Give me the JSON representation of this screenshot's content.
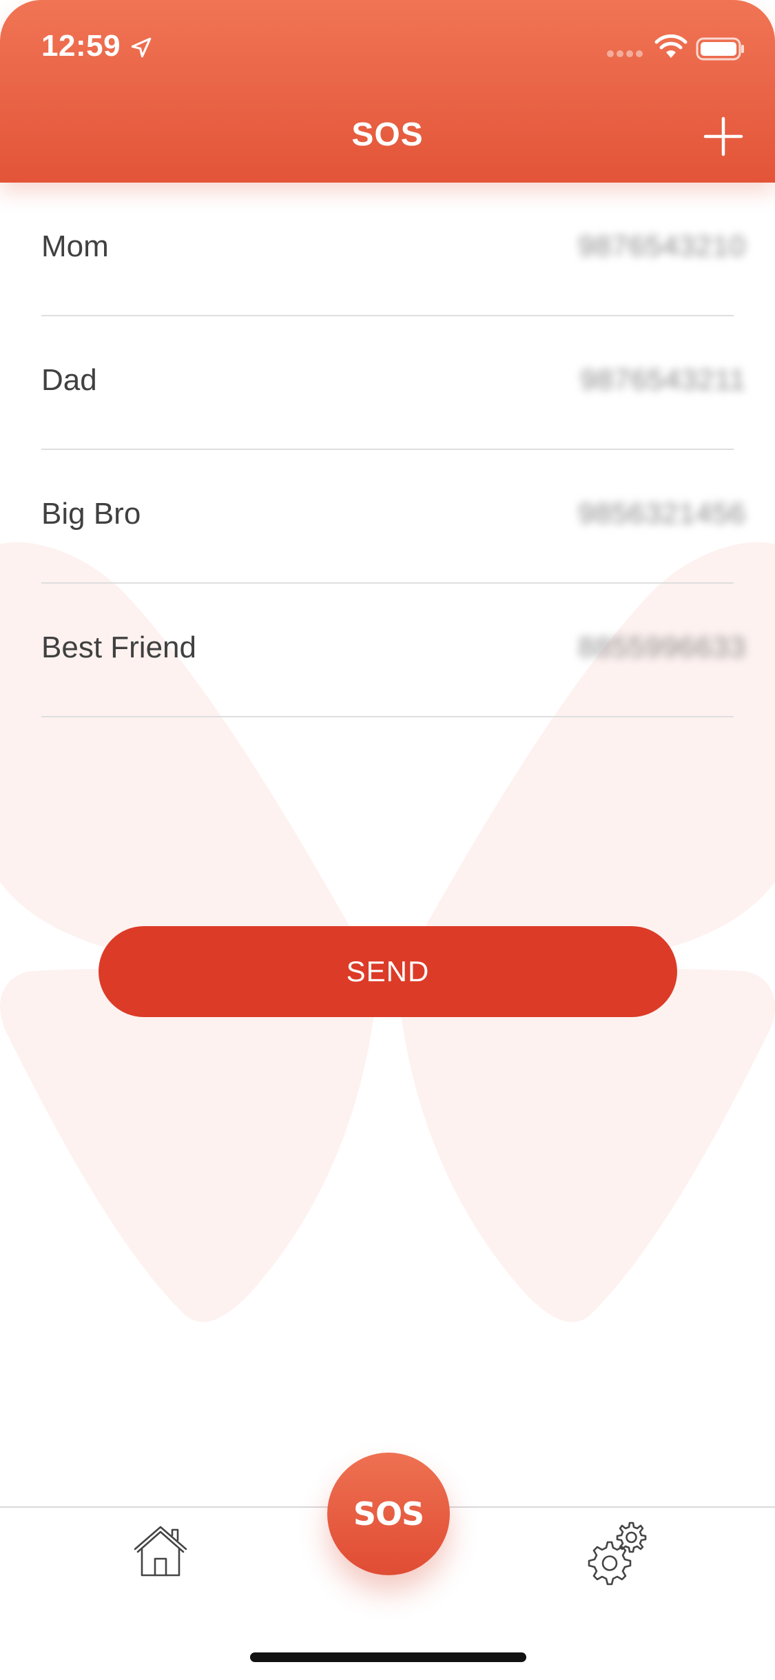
{
  "status_bar": {
    "time": "12:59"
  },
  "nav": {
    "title": "SOS",
    "add_icon": "plus-icon"
  },
  "contacts": [
    {
      "name": "Mom",
      "phone": "9876543210"
    },
    {
      "name": "Dad",
      "phone": "9876543211"
    },
    {
      "name": "Big Bro",
      "phone": "9856321456"
    },
    {
      "name": "Best Friend",
      "phone": "8855996633"
    }
  ],
  "actions": {
    "send_label": "SEND"
  },
  "tab_bar": {
    "sos_label": "SOS",
    "home_icon": "home-icon",
    "settings_icon": "settings-gears-icon"
  },
  "colors": {
    "header_top": "#f07555",
    "header_bottom": "#e35438",
    "send_button": "#dc3b28",
    "butterfly_tint": "#fdf1ef"
  }
}
